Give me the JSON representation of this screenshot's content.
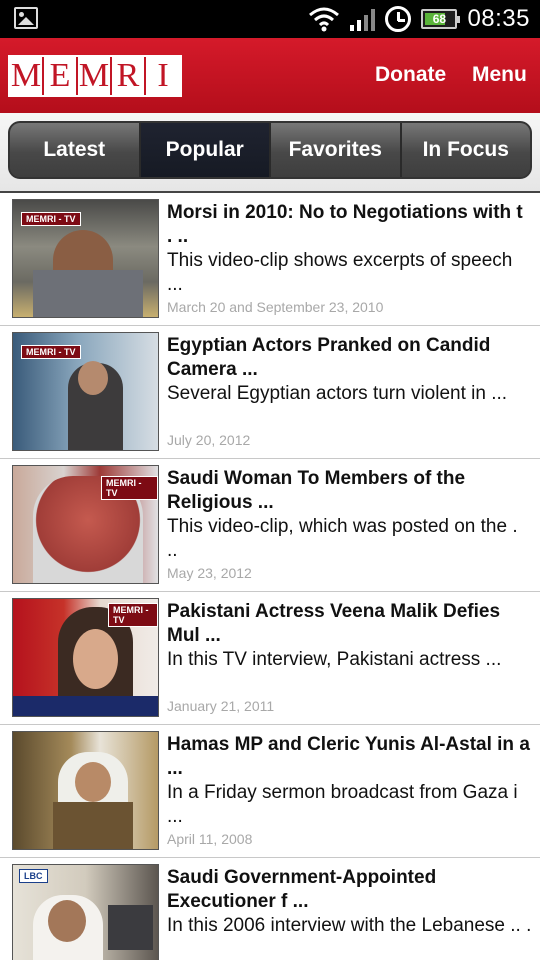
{
  "status": {
    "battery": "68",
    "time": "08:35"
  },
  "header": {
    "logo_letters": [
      "M",
      "E",
      "M",
      "R",
      "I"
    ],
    "donate": "Donate",
    "menu": "Menu"
  },
  "tabs": [
    {
      "label": "Latest"
    },
    {
      "label": "Popular"
    },
    {
      "label": "Favorites"
    },
    {
      "label": "In Focus"
    }
  ],
  "items": [
    {
      "title": "Morsi in 2010: No to Negotiations with t . ..",
      "desc": "This video-clip shows excerpts of speech ...",
      "date": "March 20 and September 23, 2010",
      "thumb_logo": "MEMRI - TV"
    },
    {
      "title": "Egyptian Actors Pranked on Candid Camera ...",
      "desc": "Several Egyptian actors turn violent in  ...",
      "date": "July 20, 2012",
      "thumb_logo": "MEMRI - TV"
    },
    {
      "title": "Saudi Woman To Members of the Religious  ...",
      "desc": "This video-clip, which was posted on the . ..",
      "date": "May 23, 2012",
      "thumb_logo": "MEMRI - TV"
    },
    {
      "title": "Pakistani Actress Veena Malik Defies Mul ...",
      "desc": "In this TV interview, Pakistani actress  ...",
      "date": "January 21, 2011",
      "thumb_logo": "MEMRI - TV"
    },
    {
      "title": "Hamas MP and Cleric Yunis Al-Astal in a ...",
      "desc": "In a Friday sermon broadcast from Gaza i ...",
      "date": "April 11, 2008",
      "thumb_logo": ""
    },
    {
      "title": "Saudi Government-Appointed Executioner f ...",
      "desc": "In this 2006 interview with the Lebanese .. .",
      "date": "",
      "thumb_logo": "LBC"
    }
  ]
}
